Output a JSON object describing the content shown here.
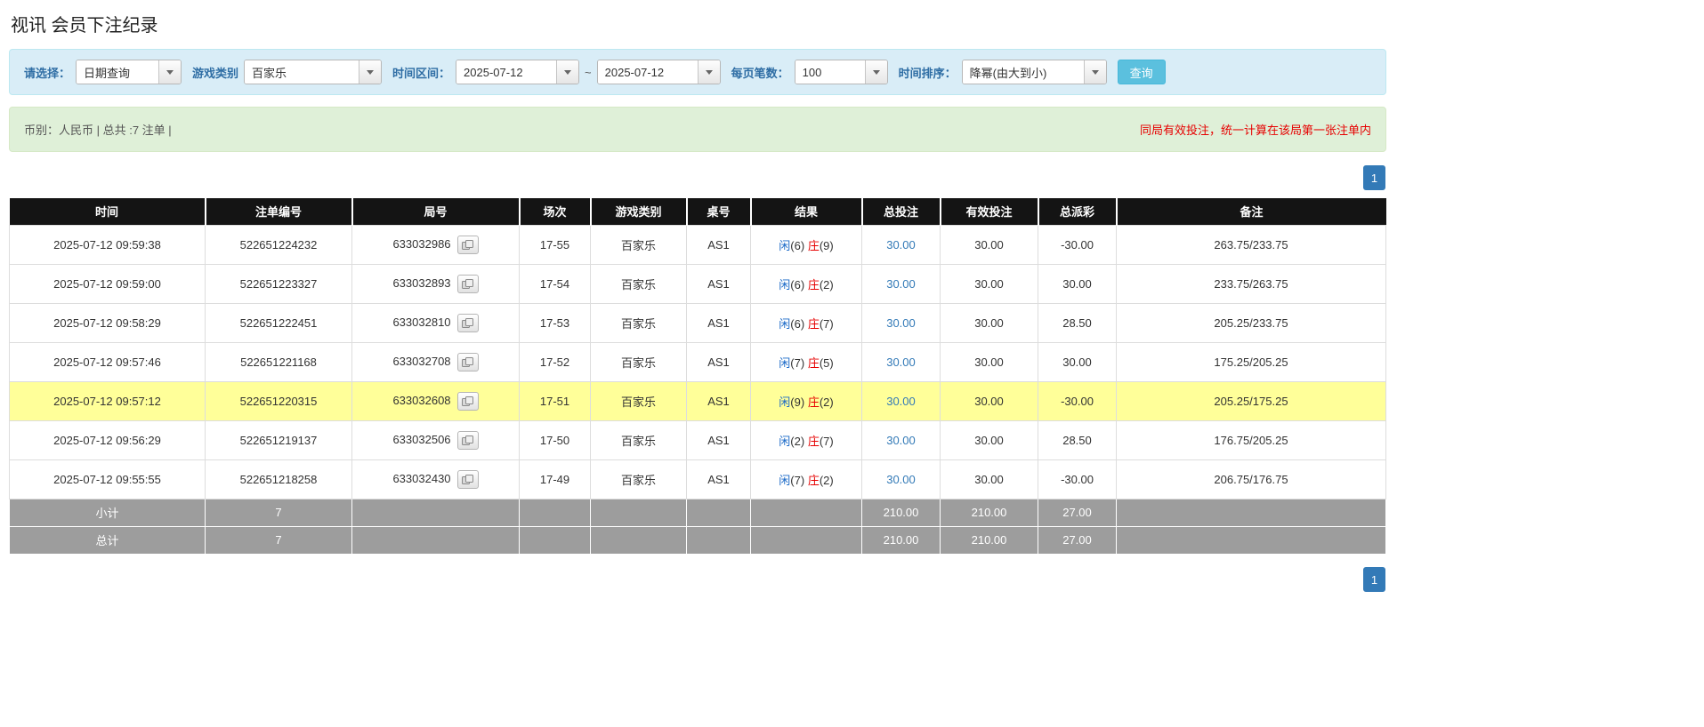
{
  "page_title": "视讯 会员下注纪录",
  "filter_bar": {
    "select_label": "请选择：",
    "select_value": "日期查询",
    "game_type_label": "游戏类别",
    "game_type_value": "百家乐",
    "time_range_label": "时间区间：",
    "date_from": "2025-07-12",
    "range_separator": "~",
    "date_to": "2025-07-12",
    "page_size_label": "每页笔数：",
    "page_size_value": "100",
    "sort_label": "时间排序：",
    "sort_value": "降幂(由大到小)",
    "search_button_label": "查询"
  },
  "summary_bar": {
    "left_text": "币别：人民币 | 总共 :7 注单 |",
    "right_notice": "同局有效投注，统一计算在该局第一张注单内"
  },
  "pagination": {
    "current_page": "1"
  },
  "icons": {
    "dropdown": "chevron-down-icon",
    "round_detail": "cards-icon"
  },
  "colors": {
    "accent_blue": "#337ab7",
    "button_info_blue": "#5bc0de",
    "filter_bg": "#d9edf7",
    "summary_bg": "#dff0d8",
    "header_black": "#141414",
    "footer_gray": "#9d9d9d",
    "highlight_yellow": "#ffff99",
    "player_blue": "#1a69c7",
    "banker_red": "#e60000",
    "negative_red": "#e60000"
  },
  "table": {
    "headers": [
      "时间",
      "注单编号",
      "局号",
      "场次",
      "游戏类别",
      "桌号",
      "结果",
      "总投注",
      "有效投注",
      "总派彩",
      "备注"
    ],
    "rows": [
      {
        "time": "2025-07-12 09:59:38",
        "bet_id": "522651224232",
        "round_id": "633032986",
        "session": "17-55",
        "game_type": "百家乐",
        "table_no": "AS1",
        "player_label": "闲",
        "player_score": "(6)",
        "banker_label": "庄",
        "banker_score": "(9)",
        "total_bet": "30.00",
        "valid_bet": "30.00",
        "payout": "-30.00",
        "remark": "263.75/233.75",
        "highlighted": false
      },
      {
        "time": "2025-07-12 09:59:00",
        "bet_id": "522651223327",
        "round_id": "633032893",
        "session": "17-54",
        "game_type": "百家乐",
        "table_no": "AS1",
        "player_label": "闲",
        "player_score": "(6)",
        "banker_label": "庄",
        "banker_score": "(2)",
        "total_bet": "30.00",
        "valid_bet": "30.00",
        "payout": "30.00",
        "remark": "233.75/263.75",
        "highlighted": false
      },
      {
        "time": "2025-07-12 09:58:29",
        "bet_id": "522651222451",
        "round_id": "633032810",
        "session": "17-53",
        "game_type": "百家乐",
        "table_no": "AS1",
        "player_label": "闲",
        "player_score": "(6)",
        "banker_label": "庄",
        "banker_score": "(7)",
        "total_bet": "30.00",
        "valid_bet": "30.00",
        "payout": "28.50",
        "remark": "205.25/233.75",
        "highlighted": false
      },
      {
        "time": "2025-07-12 09:57:46",
        "bet_id": "522651221168",
        "round_id": "633032708",
        "session": "17-52",
        "game_type": "百家乐",
        "table_no": "AS1",
        "player_label": "闲",
        "player_score": "(7)",
        "banker_label": "庄",
        "banker_score": "(5)",
        "total_bet": "30.00",
        "valid_bet": "30.00",
        "payout": "30.00",
        "remark": "175.25/205.25",
        "highlighted": false
      },
      {
        "time": "2025-07-12 09:57:12",
        "bet_id": "522651220315",
        "round_id": "633032608",
        "session": "17-51",
        "game_type": "百家乐",
        "table_no": "AS1",
        "player_label": "闲",
        "player_score": "(9)",
        "banker_label": "庄",
        "banker_score": "(2)",
        "total_bet": "30.00",
        "valid_bet": "30.00",
        "payout": "-30.00",
        "remark": "205.25/175.25",
        "highlighted": true
      },
      {
        "time": "2025-07-12 09:56:29",
        "bet_id": "522651219137",
        "round_id": "633032506",
        "session": "17-50",
        "game_type": "百家乐",
        "table_no": "AS1",
        "player_label": "闲",
        "player_score": "(2)",
        "banker_label": "庄",
        "banker_score": "(7)",
        "total_bet": "30.00",
        "valid_bet": "30.00",
        "payout": "28.50",
        "remark": "176.75/205.25",
        "highlighted": false
      },
      {
        "time": "2025-07-12 09:55:55",
        "bet_id": "522651218258",
        "round_id": "633032430",
        "session": "17-49",
        "game_type": "百家乐",
        "table_no": "AS1",
        "player_label": "闲",
        "player_score": "(7)",
        "banker_label": "庄",
        "banker_score": "(2)",
        "total_bet": "30.00",
        "valid_bet": "30.00",
        "payout": "-30.00",
        "remark": "206.75/176.75",
        "highlighted": false
      }
    ],
    "subtotal_row": {
      "label": "小计",
      "count": "7",
      "total_bet": "210.00",
      "valid_bet": "210.00",
      "payout": "27.00"
    },
    "total_row": {
      "label": "总计",
      "count": "7",
      "total_bet": "210.00",
      "valid_bet": "210.00",
      "payout": "27.00"
    }
  }
}
